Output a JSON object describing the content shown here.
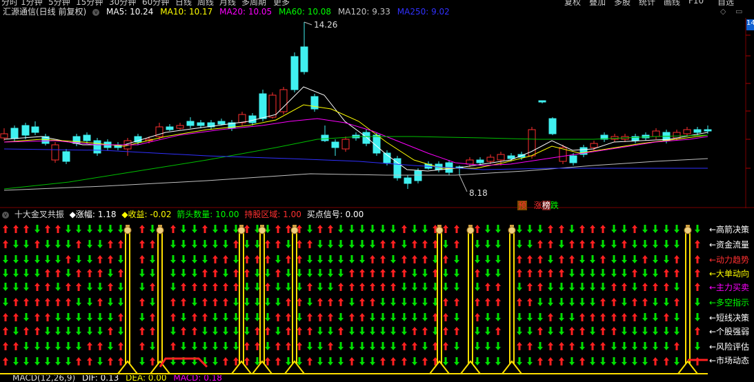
{
  "top_menu": [
    "分时",
    "1分钟",
    "5分钟",
    "15分钟",
    "30分钟",
    "60分钟",
    "日线",
    "周线",
    "月线",
    "多周期",
    "更多",
    "复权",
    "叠加",
    "多股",
    "统计",
    "画线",
    "F10",
    "自选"
  ],
  "chart": {
    "title": "汇源通信(日线 前复权)",
    "ma": [
      {
        "label": "MA5: 10.24",
        "color": "#ffffff"
      },
      {
        "label": "MA10: 10.17",
        "color": "#ffff00"
      },
      {
        "label": "MA20: 10.05",
        "color": "#ff00ff"
      },
      {
        "label": "MA60: 10.08",
        "color": "#00ff00"
      },
      {
        "label": "MA120: 9.33",
        "color": "#c0c0c0"
      },
      {
        "label": "MA250: 9.02",
        "color": "#3030ff"
      }
    ],
    "high_label": "14.26",
    "low_label": "8.18",
    "right_tab": "14",
    "tags": [
      {
        "text": "预",
        "color": "#ff3030",
        "bg": "#7a4a00"
      },
      {
        "text": "涨",
        "color": "#ff3030",
        "bg": "#000000"
      },
      {
        "text": "榜",
        "color": "#ffffff",
        "bg": "#7a1a1a"
      },
      {
        "text": "跌",
        "color": "#00ff00",
        "bg": "#000000"
      }
    ]
  },
  "indicator": {
    "name": "十大金叉共振",
    "items": [
      {
        "label": "◆涨幅: 1.18",
        "color": "#ffffff"
      },
      {
        "label": "◆收益: -0.02",
        "color": "#ffff00"
      },
      {
        "label": "箭头数量: 10.00",
        "color": "#00ff00"
      },
      {
        "label": "持股区域: 1.00",
        "color": "#ff3030"
      },
      {
        "label": "买点信号: 0.00",
        "color": "#ffffff"
      }
    ],
    "rows": [
      {
        "label": "←高箭决策",
        "color": "#ffffff"
      },
      {
        "label": "←资金流量",
        "color": "#ffffff"
      },
      {
        "label": "←动力趋势",
        "color": "#ff3030"
      },
      {
        "label": "←大单动向",
        "color": "#ffff00"
      },
      {
        "label": "←主力买卖",
        "color": "#ff00ff"
      },
      {
        "label": "←多空指示",
        "color": "#00ff00"
      },
      {
        "label": "←短线决策",
        "color": "#ffffff"
      },
      {
        "label": "←个股强弱",
        "color": "#ffffff"
      },
      {
        "label": "←风险评估",
        "color": "#ffffff"
      },
      {
        "label": "←市场动态",
        "color": "#ffffff"
      }
    ],
    "signal_icon": "money-bag-icon",
    "up_color": "#ff2020",
    "down_color": "#00e000"
  },
  "macd": {
    "name": "MACD(12,26,9)",
    "dif": "DIF: 0.13",
    "dea": "DEA: 0.00",
    "macd": "MACD: 0.18"
  }
}
